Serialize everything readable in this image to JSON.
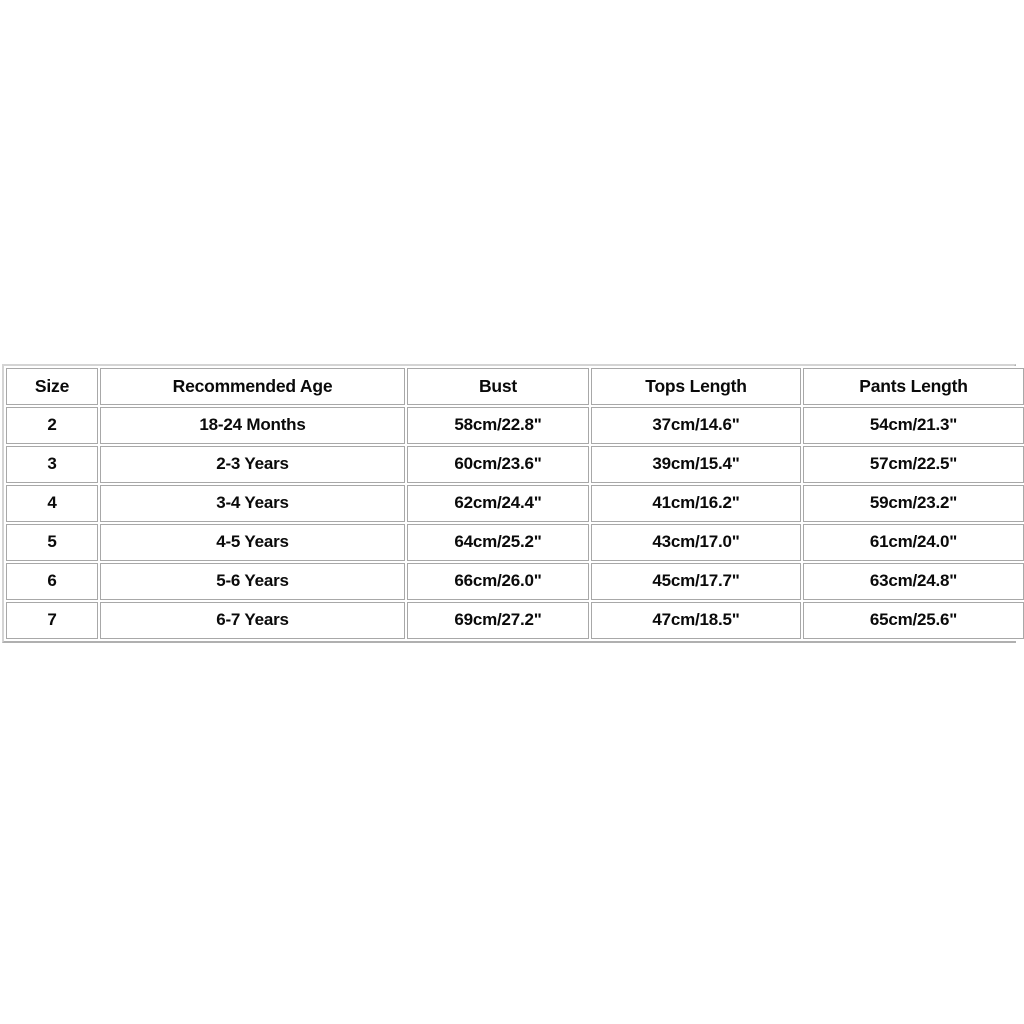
{
  "page": {
    "background_color": "#ffffff",
    "text_color": "#0a0a0a",
    "border_color": "#a8a8a8"
  },
  "table": {
    "name": "size-chart",
    "columns": [
      "Size",
      "Recommended Age",
      "Bust",
      "Tops Length",
      "Pants Length"
    ],
    "rows": [
      {
        "size": "2",
        "age": "18-24 Months",
        "bust": "58cm/22.8\"",
        "tops_length": "37cm/14.6\"",
        "pants_length": "54cm/21.3\""
      },
      {
        "size": "3",
        "age": "2-3 Years",
        "bust": "60cm/23.6\"",
        "tops_length": "39cm/15.4\"",
        "pants_length": "57cm/22.5\""
      },
      {
        "size": "4",
        "age": "3-4 Years",
        "bust": "62cm/24.4\"",
        "tops_length": "41cm/16.2\"",
        "pants_length": "59cm/23.2\""
      },
      {
        "size": "5",
        "age": "4-5 Years",
        "bust": "64cm/25.2\"",
        "tops_length": "43cm/17.0\"",
        "pants_length": "61cm/24.0\""
      },
      {
        "size": "6",
        "age": "5-6 Years",
        "bust": "66cm/26.0\"",
        "tops_length": "45cm/17.7\"",
        "pants_length": "63cm/24.8\""
      },
      {
        "size": "7",
        "age": "6-7 Years",
        "bust": "69cm/27.2\"",
        "tops_length": "47cm/18.5\"",
        "pants_length": "65cm/25.6\""
      }
    ]
  }
}
